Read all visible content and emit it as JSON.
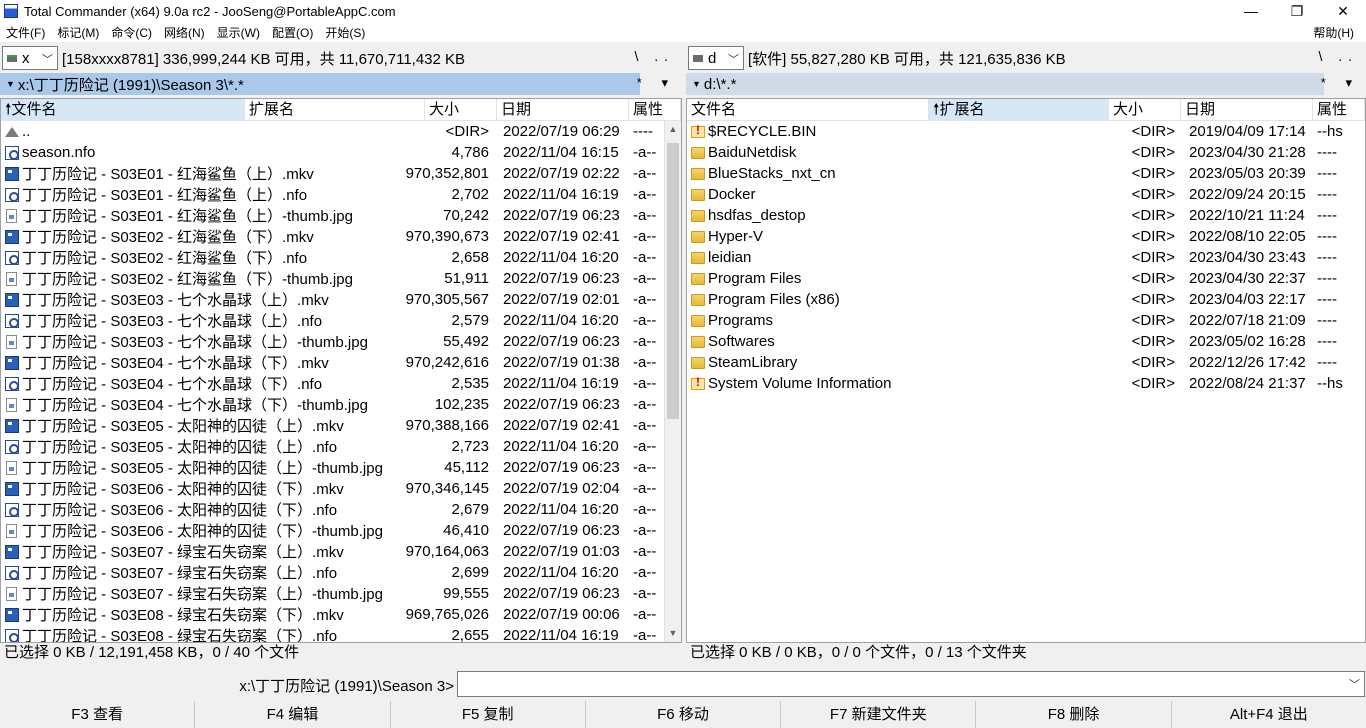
{
  "window": {
    "title": "Total Commander (x64) 9.0a rc2 - JooSeng@PortableAppC.com",
    "minimize": "—",
    "maximize": "❐",
    "close": "✕"
  },
  "menu": {
    "items": [
      "文件(F)",
      "标记(M)",
      "命令(C)",
      "网络(N)",
      "显示(W)",
      "配置(O)",
      "开始(S)"
    ],
    "help": "帮助(H)"
  },
  "left": {
    "drive": "x",
    "drive_info": "[158xxxx8781]  336,999,244 KB 可用，共 11,670,711,432 KB",
    "nav": "\\ ..",
    "path": "x:\\丁丁历险记 (1991)\\Season 3\\*.*",
    "filter": "* ▾",
    "headers": {
      "name": "文件名",
      "ext": "扩展名",
      "size": "大小",
      "date": "日期",
      "attr": "属性"
    },
    "files": [
      {
        "icon": "up",
        "name": "..",
        "size": "<DIR>",
        "date": "2022/07/19 06:29",
        "attr": "----"
      },
      {
        "icon": "nfo",
        "name": "season.nfo",
        "size": "4,786",
        "date": "2022/11/04 16:15",
        "attr": "-a--"
      },
      {
        "icon": "mkv",
        "name": "丁丁历险记 - S03E01 - 红海鲨鱼（上）.mkv",
        "size": "970,352,801",
        "date": "2022/07/19 02:22",
        "attr": "-a--"
      },
      {
        "icon": "nfo",
        "name": "丁丁历险记 - S03E01 - 红海鲨鱼（上）.nfo",
        "size": "2,702",
        "date": "2022/11/04 16:19",
        "attr": "-a--"
      },
      {
        "icon": "jpg",
        "name": "丁丁历险记 - S03E01 - 红海鲨鱼（上）-thumb.jpg",
        "size": "70,242",
        "date": "2022/07/19 06:23",
        "attr": "-a--"
      },
      {
        "icon": "mkv",
        "name": "丁丁历险记 - S03E02 - 红海鲨鱼（下）.mkv",
        "size": "970,390,673",
        "date": "2022/07/19 02:41",
        "attr": "-a--"
      },
      {
        "icon": "nfo",
        "name": "丁丁历险记 - S03E02 - 红海鲨鱼（下）.nfo",
        "size": "2,658",
        "date": "2022/11/04 16:20",
        "attr": "-a--"
      },
      {
        "icon": "jpg",
        "name": "丁丁历险记 - S03E02 - 红海鲨鱼（下）-thumb.jpg",
        "size": "51,911",
        "date": "2022/07/19 06:23",
        "attr": "-a--"
      },
      {
        "icon": "mkv",
        "name": "丁丁历险记 - S03E03 - 七个水晶球（上）.mkv",
        "size": "970,305,567",
        "date": "2022/07/19 02:01",
        "attr": "-a--"
      },
      {
        "icon": "nfo",
        "name": "丁丁历险记 - S03E03 - 七个水晶球（上）.nfo",
        "size": "2,579",
        "date": "2022/11/04 16:20",
        "attr": "-a--"
      },
      {
        "icon": "jpg",
        "name": "丁丁历险记 - S03E03 - 七个水晶球（上）-thumb.jpg",
        "size": "55,492",
        "date": "2022/07/19 06:23",
        "attr": "-a--"
      },
      {
        "icon": "mkv",
        "name": "丁丁历险记 - S03E04 - 七个水晶球（下）.mkv",
        "size": "970,242,616",
        "date": "2022/07/19 01:38",
        "attr": "-a--"
      },
      {
        "icon": "nfo",
        "name": "丁丁历险记 - S03E04 - 七个水晶球（下）.nfo",
        "size": "2,535",
        "date": "2022/11/04 16:19",
        "attr": "-a--"
      },
      {
        "icon": "jpg",
        "name": "丁丁历险记 - S03E04 - 七个水晶球（下）-thumb.jpg",
        "size": "102,235",
        "date": "2022/07/19 06:23",
        "attr": "-a--"
      },
      {
        "icon": "mkv",
        "name": "丁丁历险记 - S03E05 - 太阳神的囚徒（上）.mkv",
        "size": "970,388,166",
        "date": "2022/07/19 02:41",
        "attr": "-a--"
      },
      {
        "icon": "nfo",
        "name": "丁丁历险记 - S03E05 - 太阳神的囚徒（上）.nfo",
        "size": "2,723",
        "date": "2022/11/04 16:20",
        "attr": "-a--"
      },
      {
        "icon": "jpg",
        "name": "丁丁历险记 - S03E05 - 太阳神的囚徒（上）-thumb.jpg",
        "size": "45,112",
        "date": "2022/07/19 06:23",
        "attr": "-a--"
      },
      {
        "icon": "mkv",
        "name": "丁丁历险记 - S03E06 - 太阳神的囚徒（下）.mkv",
        "size": "970,346,145",
        "date": "2022/07/19 02:04",
        "attr": "-a--"
      },
      {
        "icon": "nfo",
        "name": "丁丁历险记 - S03E06 - 太阳神的囚徒（下）.nfo",
        "size": "2,679",
        "date": "2022/11/04 16:20",
        "attr": "-a--"
      },
      {
        "icon": "jpg",
        "name": "丁丁历险记 - S03E06 - 太阳神的囚徒（下）-thumb.jpg",
        "size": "46,410",
        "date": "2022/07/19 06:23",
        "attr": "-a--"
      },
      {
        "icon": "mkv",
        "name": "丁丁历险记 - S03E07 - 绿宝石失窃案（上）.mkv",
        "size": "970,164,063",
        "date": "2022/07/19 01:03",
        "attr": "-a--"
      },
      {
        "icon": "nfo",
        "name": "丁丁历险记 - S03E07 - 绿宝石失窃案（上）.nfo",
        "size": "2,699",
        "date": "2022/11/04 16:20",
        "attr": "-a--"
      },
      {
        "icon": "jpg",
        "name": "丁丁历险记 - S03E07 - 绿宝石失窃案（上）-thumb.jpg",
        "size": "99,555",
        "date": "2022/07/19 06:23",
        "attr": "-a--"
      },
      {
        "icon": "mkv",
        "name": "丁丁历险记 - S03E08 - 绿宝石失窃案（下）.mkv",
        "size": "969,765,026",
        "date": "2022/07/19 00:06",
        "attr": "-a--"
      },
      {
        "icon": "nfo",
        "name": "丁丁历险记 - S03E08 - 绿宝石失窃案（下）.nfo",
        "size": "2,655",
        "date": "2022/11/04 16:19",
        "attr": "-a--"
      }
    ],
    "status": "已选择 0 KB / 12,191,458 KB，0 / 40 个文件"
  },
  "right": {
    "drive": "d",
    "drive_info": "[软件]  55,827,280 KB 可用，共 121,635,836 KB",
    "nav": "\\ ..",
    "path": "d:\\*.*",
    "filter": "* ▾",
    "headers": {
      "name": "文件名",
      "ext": "扩展名",
      "size": "大小",
      "date": "日期",
      "attr": "属性"
    },
    "files": [
      {
        "icon": "sysfolder",
        "name": "$RECYCLE.BIN",
        "size": "<DIR>",
        "date": "2019/04/09 17:14",
        "attr": "--hs"
      },
      {
        "icon": "folder",
        "name": "BaiduNetdisk",
        "size": "<DIR>",
        "date": "2023/04/30 21:28",
        "attr": "----"
      },
      {
        "icon": "folder",
        "name": "BlueStacks_nxt_cn",
        "size": "<DIR>",
        "date": "2023/05/03 20:39",
        "attr": "----"
      },
      {
        "icon": "folder",
        "name": "Docker",
        "size": "<DIR>",
        "date": "2022/09/24 20:15",
        "attr": "----"
      },
      {
        "icon": "folder",
        "name": "hsdfas_destop",
        "size": "<DIR>",
        "date": "2022/10/21 11:24",
        "attr": "----"
      },
      {
        "icon": "folder",
        "name": "Hyper-V",
        "size": "<DIR>",
        "date": "2022/08/10 22:05",
        "attr": "----"
      },
      {
        "icon": "folder",
        "name": "leidian",
        "size": "<DIR>",
        "date": "2023/04/30 23:43",
        "attr": "----"
      },
      {
        "icon": "folder",
        "name": "Program Files",
        "size": "<DIR>",
        "date": "2023/04/30 22:37",
        "attr": "----"
      },
      {
        "icon": "folder",
        "name": "Program Files (x86)",
        "size": "<DIR>",
        "date": "2023/04/03 22:17",
        "attr": "----"
      },
      {
        "icon": "folder",
        "name": "Programs",
        "size": "<DIR>",
        "date": "2022/07/18 21:09",
        "attr": "----"
      },
      {
        "icon": "folder",
        "name": "Softwares",
        "size": "<DIR>",
        "date": "2023/05/02 16:28",
        "attr": "----"
      },
      {
        "icon": "folder",
        "name": "SteamLibrary",
        "size": "<DIR>",
        "date": "2022/12/26 17:42",
        "attr": "----"
      },
      {
        "icon": "sysfolder",
        "name": "System Volume Information",
        "size": "<DIR>",
        "date": "2022/08/24 21:37",
        "attr": "--hs"
      }
    ],
    "status": "已选择 0 KB / 0 KB，0 / 0 个文件，0 / 13 个文件夹"
  },
  "cmdline": {
    "label": "x:\\丁丁历险记 (1991)\\Season 3>",
    "value": ""
  },
  "fkeys": [
    "F3 查看",
    "F4 编辑",
    "F5 复制",
    "F6 移动",
    "F7 新建文件夹",
    "F8 删除",
    "Alt+F4 退出"
  ]
}
